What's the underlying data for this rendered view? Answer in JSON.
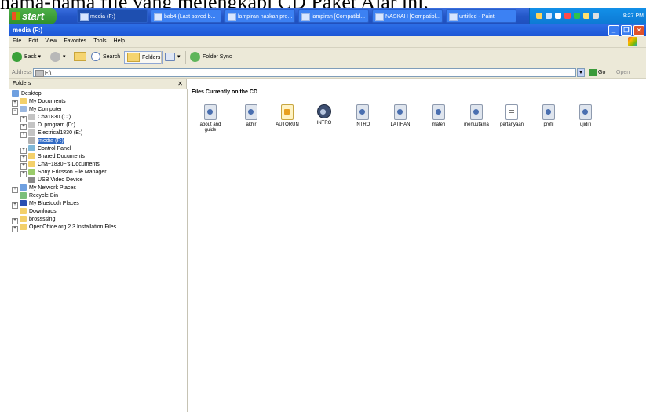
{
  "caption": "nama-nama file yang melengkapi CD Paket Ajar ini.",
  "taskbar": {
    "start_label": "start",
    "items": [
      "media (F:)",
      "bab4 (Last saved b...",
      "lampiran naskah pro...",
      "lampiran [Compatibl...",
      "NASKAH [Compatibl...",
      "untitled - Paint"
    ],
    "clock": "8:27 PM"
  },
  "window": {
    "title": "media (F:)",
    "menu": [
      "File",
      "Edit",
      "View",
      "Favorites",
      "Tools",
      "Help"
    ],
    "toolbar": {
      "back": "Back",
      "search": "Search",
      "folders": "Folders",
      "folder_sync": "Folder Sync"
    },
    "address": {
      "label": "Address",
      "value": "F:\\",
      "go": "Go",
      "open": "Open"
    }
  },
  "folders_pane": {
    "title": "Folders",
    "tree": [
      {
        "label": "Desktop",
        "icon": "desktop-icon"
      },
      {
        "label": "My Documents",
        "icon": "folder-icon"
      },
      {
        "label": "My Computer",
        "icon": "computer-icon"
      },
      {
        "label": "Cha1830 (C:)",
        "icon": "drive-icon"
      },
      {
        "label": "D' program (D:)",
        "icon": "drive-icon"
      },
      {
        "label": "Electrical1830 (E:)",
        "icon": "drive-icon"
      },
      {
        "label": "media (F:)",
        "icon": "cd-drive-icon"
      },
      {
        "label": "Control Panel",
        "icon": "control-panel-icon"
      },
      {
        "label": "Shared Documents",
        "icon": "folder-icon"
      },
      {
        "label": "Cha~1830~'s Documents",
        "icon": "folder-icon"
      },
      {
        "label": "Sony Ericsson File Manager",
        "icon": "phone-icon"
      },
      {
        "label": "USB Video Device",
        "icon": "camera-icon"
      },
      {
        "label": "My Network Places",
        "icon": "network-icon"
      },
      {
        "label": "Recycle Bin",
        "icon": "recycle-bin-icon"
      },
      {
        "label": "My Bluetooth Places",
        "icon": "bluetooth-icon"
      },
      {
        "label": "Downloads",
        "icon": "folder-icon"
      },
      {
        "label": "brossssing",
        "icon": "folder-icon"
      },
      {
        "label": "OpenOffice.org 2.3 Installation Files",
        "icon": "folder-icon"
      }
    ]
  },
  "content": {
    "heading": "Files Currently on the CD",
    "files": [
      {
        "name": "about and guide",
        "icon": "document-icon"
      },
      {
        "name": "akhir",
        "icon": "document-icon"
      },
      {
        "name": "AUTORUN",
        "icon": "autorun-icon"
      },
      {
        "name": "INTRO",
        "icon": "intro-exe-icon"
      },
      {
        "name": "INTRO",
        "icon": "document-icon"
      },
      {
        "name": "LATIHAN",
        "icon": "document-icon"
      },
      {
        "name": "materi",
        "icon": "document-icon"
      },
      {
        "name": "menuutama",
        "icon": "document-icon"
      },
      {
        "name": "pertanyaan",
        "icon": "text-file-icon"
      },
      {
        "name": "profil",
        "icon": "document-icon"
      },
      {
        "name": "ujidiri",
        "icon": "document-icon"
      }
    ]
  },
  "colors": {
    "taskbar": "#2457c8",
    "start": "#3a9a35",
    "titlebar": "#1f5ad8",
    "chrome": "#ece9d8",
    "selection": "#316ac5"
  }
}
